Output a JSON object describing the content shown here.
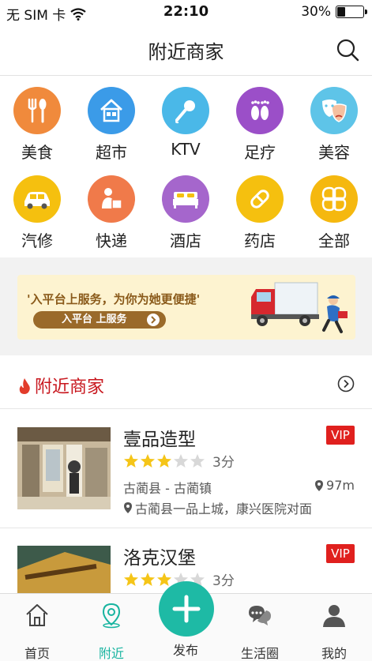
{
  "status_bar": {
    "carrier": "无 SIM 卡",
    "time": "22:10",
    "battery": "30%",
    "battery_level": 0.3
  },
  "nav": {
    "title": "附近商家",
    "search_icon": "search-icon"
  },
  "categories": [
    {
      "label": "美食",
      "icon": "fork-spoon-icon",
      "color": "#f08a3c"
    },
    {
      "label": "超市",
      "icon": "shop-house-icon",
      "color": "#3b9be8"
    },
    {
      "label": "KTV",
      "icon": "microphone-icon",
      "color": "#4ab8e8"
    },
    {
      "label": "足疗",
      "icon": "footprints-icon",
      "color": "#9b4fc8"
    },
    {
      "label": "美容",
      "icon": "masks-icon",
      "color": "#5ec4e8"
    },
    {
      "label": "汽修",
      "icon": "car-icon",
      "color": "#f5c00f"
    },
    {
      "label": "快递",
      "icon": "courier-icon",
      "color": "#f07a4a"
    },
    {
      "label": "酒店",
      "icon": "bed-icon",
      "color": "#a566cc"
    },
    {
      "label": "药店",
      "icon": "pill-icon",
      "color": "#f5c00f"
    },
    {
      "label": "全部",
      "icon": "grid-flower-icon",
      "color": "#f5b80f"
    }
  ],
  "banner": {
    "slogan": "'入平台上服务，为你为她更便捷'",
    "button_label": "入平台  上服务"
  },
  "section": {
    "title": "附近商家"
  },
  "shops": [
    {
      "name": "壹品造型",
      "badge": "VIP",
      "rating": 3,
      "score": "3分",
      "area": "古蔺县 - 古蔺镇",
      "distance": "97m",
      "address": "古蔺县一品上城，康兴医院对面"
    },
    {
      "name": "洛克汉堡",
      "badge": "VIP",
      "rating": 3,
      "score": "3分"
    }
  ],
  "tabs": [
    {
      "label": "首页",
      "icon": "home-icon"
    },
    {
      "label": "附近",
      "icon": "location-pin-icon"
    },
    {
      "label": "发布",
      "icon": "plus-icon"
    },
    {
      "label": "生活圈",
      "icon": "chat-bubbles-icon"
    },
    {
      "label": "我的",
      "icon": "user-icon"
    }
  ],
  "colors": {
    "accent": "#1ebaa5",
    "vip": "#e0201e",
    "section_title": "#c8171e",
    "star_on": "#f5c518",
    "star_off": "#d8d8d8"
  }
}
